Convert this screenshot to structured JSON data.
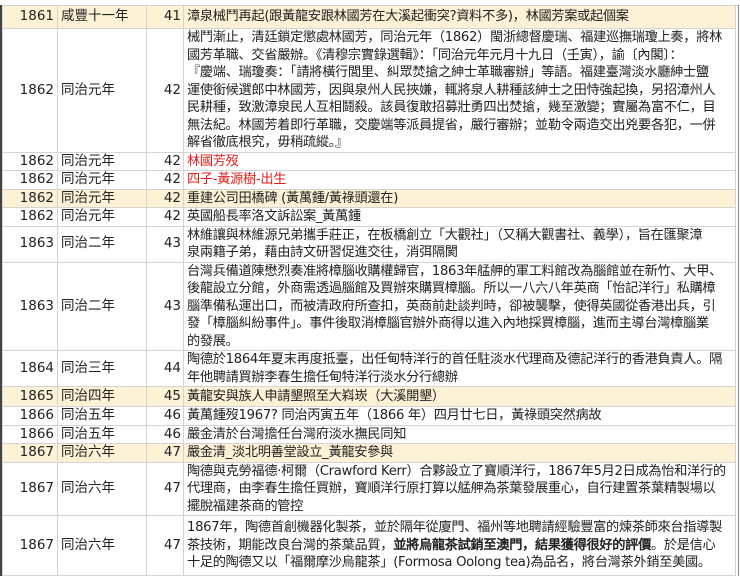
{
  "colors": {
    "highlight": "#fdf1d6",
    "red_text": "#e0201c"
  },
  "rows": [
    {
      "year": "1861",
      "era": "咸豐十一年",
      "num": "41",
      "hl": true,
      "lines": [
        "漳泉械鬥再起(跟黃龍安跟林國芳在大溪起衝突?資料不多)，林國芳案或起個案"
      ]
    },
    {
      "year": "1862",
      "era": "同治元年",
      "num": "42",
      "lines": [
        "械鬥漸止，清廷鎖定懲處林國芳，同治元年（1862）閩浙總督慶瑞、福建巡撫瑞瓊上奏，將林",
        "國芳革職、交省嚴辦。《清穆宗實錄選輯》：「同治元年元月十九日（壬寅），諭〔內閣〕：",
        "『慶端、瑞瓊奏：「請將橫行閭里、糾眾焚搶之紳士革職審辦」等語。福建臺灣淡水廳紳士鹽",
        "運使銜候選郎中林國芳，因與泉州人民挾嫌，輒將泉人耕種該紳士之田恃強起換，另招漳州人",
        "民耕種，致激漳泉民人互相鬪殺。該員復敢招募壯勇四出焚搶，幾至激變；實屬為富不仁，目",
        "無法紀。林國芳着即行革職，交慶端等派員提省，嚴行審辦；並勒令兩造交出兇要各犯，一併",
        "解省徹底根究，毋稍疏縱。』"
      ]
    },
    {
      "year": "1862",
      "era": "同治元年",
      "num": "42",
      "red": true,
      "lines": [
        "林國芳歿"
      ]
    },
    {
      "year": "1862",
      "era": "同治元年",
      "num": "42",
      "red": true,
      "lines": [
        "四子-黃源樹-出生"
      ]
    },
    {
      "year": "1862",
      "era": "同治元年",
      "num": "42",
      "hl": true,
      "lines": [
        "重建公司田橋碑 (黃萬鍾/黃祿頭還在)"
      ]
    },
    {
      "year": "1862",
      "era": "同治元年",
      "num": "42",
      "lines": [
        "英國船長率洛文訴訟案_黃萬鍾"
      ]
    },
    {
      "year": "1863",
      "era": "同治二年",
      "num": "43",
      "lines": [
        "林維讓與林維源兄弟攜手莊正，在板橋創立「大觀社」（又稱大觀書社、義學），旨在匯聚漳",
        "泉兩籍子弟，藉由詩文研習促進交往，消弭隔閡"
      ]
    },
    {
      "year": "1863",
      "era": "同治二年",
      "num": "43",
      "lines": [
        "台灣兵備道陳懋烈奏准將樟腦收購權歸官，1863年艋舺的軍工料館改為腦館並在新竹、大甲、",
        "後龍設立分館，外商需透過腦館及買辦來購買樟腦。所以一八六八年英商「怡記洋行」私購樟",
        "腦準備私運出口，而被清政府所查扣，英商前赴談判時，卻被襲擊，使得英國從香港出兵，引",
        "發「樟腦糾紛事件」。事件後取消樟腦官辦外商得以進入內地採買樟腦，進而主導台灣樟腦業",
        "的發展。"
      ]
    },
    {
      "year": "1864",
      "era": "同治三年",
      "num": "44",
      "lines": [
        "陶德於1864年夏末再度抵臺，出任甸特洋行的首任駐淡水代理商及德記洋行的香港負責人。隔",
        "年他聘請買辦李春生擔任甸特洋行淡水分行總辦"
      ]
    },
    {
      "year": "1865",
      "era": "同治四年",
      "num": "45",
      "hl": true,
      "lines": [
        "黃龍安與族人申請墾照至大嵙崁（大溪開墾）"
      ]
    },
    {
      "year": "1866",
      "era": "同治五年",
      "num": "46",
      "lines": [
        "黃萬鍾歿1967? 同治丙寅五年（1866 年）四月廿七日，黃祿頭突然病故"
      ]
    },
    {
      "year": "1866",
      "era": "同治五年",
      "num": "46",
      "lines": [
        "嚴金清於台灣擔任台灣府淡水撫民同知"
      ]
    },
    {
      "year": "1867",
      "era": "同治六年",
      "num": "47",
      "hl": true,
      "lines": [
        "嚴金清_淡北明善堂設立_黃龍安參與"
      ]
    },
    {
      "year": "1867",
      "era": "同治六年",
      "num": "47",
      "lines": [
        "陶德與克勞福德·柯爾（Crawford Kerr）合夥設立了寶順洋行，1867年5月2日成為怡和洋行的",
        "代理商，由李春生擔任買辦，寶順洋行原打算以艋舺為茶葉發展重心，自行建置茶葉精製場以",
        "擺脫福建茶商的管控"
      ]
    },
    {
      "year": "1867",
      "era": "同治六年",
      "num": "47",
      "lines": [
        "1867年，陶德首創機器化製茶，並於隔年從廈門、福州等地聘請經驗豐富的煉茶師來台指導製",
        "茶技術，期能改良台灣的茶葉品質，",
        "十足的陶德又以「福爾摩沙烏龍茶」(Formosa Oolong tea)為品名，將台灣茶外銷至美國。"
      ],
      "bold_part": "並將烏龍茶試銷至澳門，結果獲得很好的評價",
      "after_bold": "。於是信心"
    }
  ]
}
